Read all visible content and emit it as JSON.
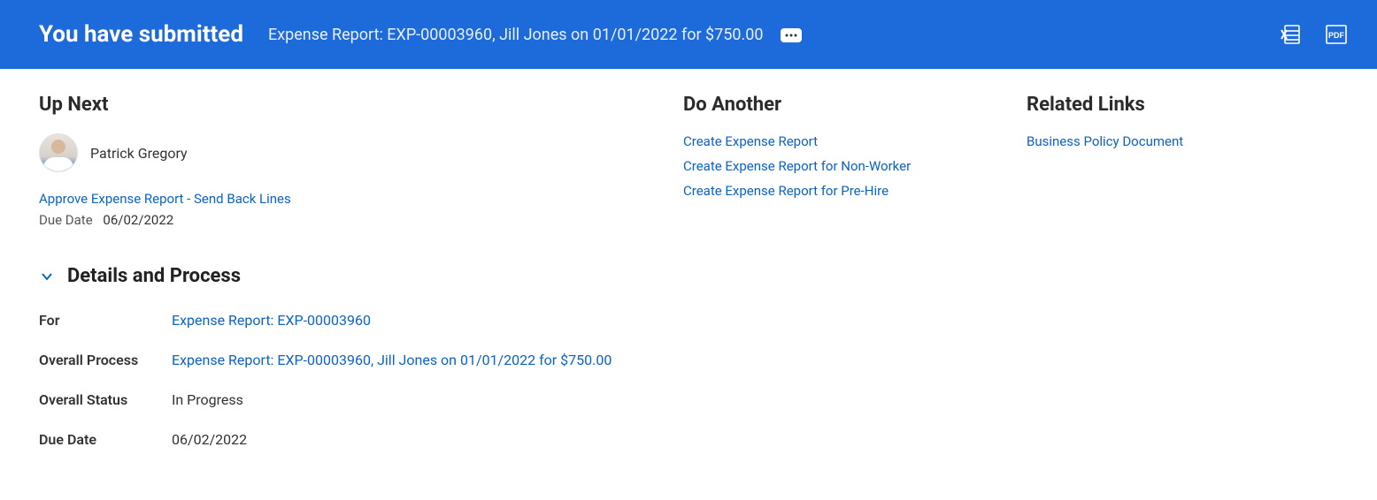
{
  "header": {
    "title": "You have submitted",
    "subtitle": "Expense Report: EXP-00003960, Jill Jones on 01/01/2022 for $750.00"
  },
  "up_next": {
    "heading": "Up Next",
    "person_name": "Patrick Gregory",
    "task_link": "Approve Expense Report - Send Back Lines",
    "due_date_label": "Due Date",
    "due_date_value": "06/02/2022"
  },
  "do_another": {
    "heading": "Do Another",
    "links": [
      "Create Expense Report",
      "Create Expense Report for Non-Worker",
      "Create Expense Report for Pre-Hire"
    ]
  },
  "related_links": {
    "heading": "Related Links",
    "links": [
      "Business Policy Document"
    ]
  },
  "details": {
    "heading": "Details and Process",
    "rows": {
      "for_label": "For",
      "for_value": "Expense Report: EXP-00003960",
      "overall_process_label": "Overall Process",
      "overall_process_value": "Expense Report: EXP-00003960, Jill Jones on 01/01/2022 for $750.00",
      "overall_status_label": "Overall Status",
      "overall_status_value": "In Progress",
      "due_date_label": "Due Date",
      "due_date_value": "06/02/2022"
    }
  }
}
